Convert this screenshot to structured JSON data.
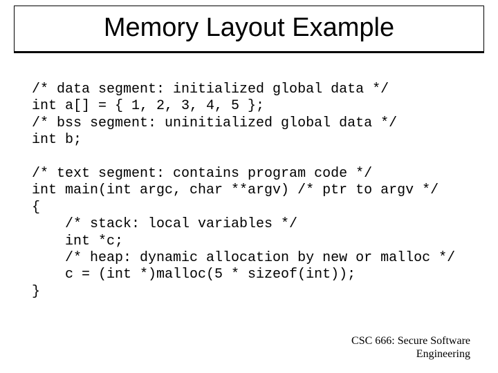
{
  "title": "Memory Layout Example",
  "code": "/* data segment: initialized global data */\nint a[] = { 1, 2, 3, 4, 5 };\n/* bss segment: uninitialized global data */\nint b;\n\n/* text segment: contains program code */\nint main(int argc, char **argv) /* ptr to argv */\n{\n    /* stack: local variables */\n    int *c;\n    /* heap: dynamic allocation by new or malloc */\n    c = (int *)malloc(5 * sizeof(int));\n}",
  "footer_line1": "CSC 666: Secure Software",
  "footer_line2": "Engineering"
}
